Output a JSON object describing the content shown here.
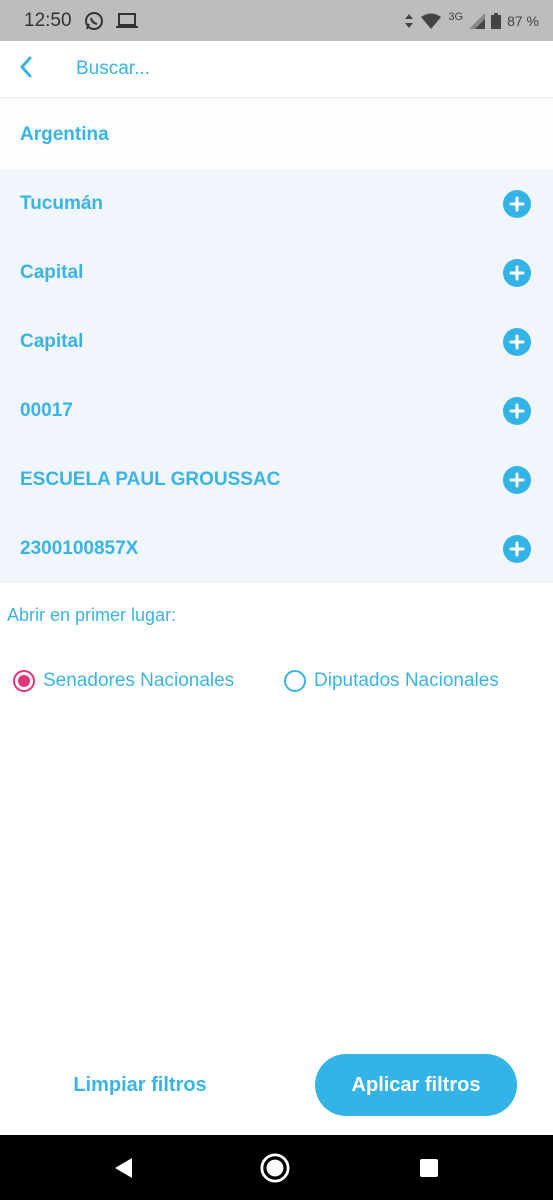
{
  "status_bar": {
    "time": "12:50",
    "battery_percent": "87 %",
    "network": "3G",
    "icons": [
      "whatsapp-icon",
      "laptop-icon",
      "data-arrows-icon",
      "wifi-icon",
      "signal-icon",
      "battery-icon"
    ]
  },
  "search": {
    "placeholder": "Buscar..."
  },
  "filters": {
    "root": "Argentina",
    "items": [
      {
        "label": "Tucumán"
      },
      {
        "label": "Capital"
      },
      {
        "label": "Capital"
      },
      {
        "label": "00017"
      },
      {
        "label": "ESCUELA PAUL GROUSSAC"
      },
      {
        "label": "2300100857X"
      }
    ]
  },
  "open_first": {
    "label": "Abrir en primer lugar:",
    "options": [
      {
        "label": "Senadores Nacionales",
        "selected": true
      },
      {
        "label": "Diputados Nacionales",
        "selected": false
      }
    ]
  },
  "actions": {
    "clear_label": "Limpiar filtros",
    "apply_label": "Aplicar filtros"
  },
  "colors": {
    "accent": "#34b3e6",
    "radio_selected": "#e0357a",
    "row_background": "#f1f6fc"
  }
}
